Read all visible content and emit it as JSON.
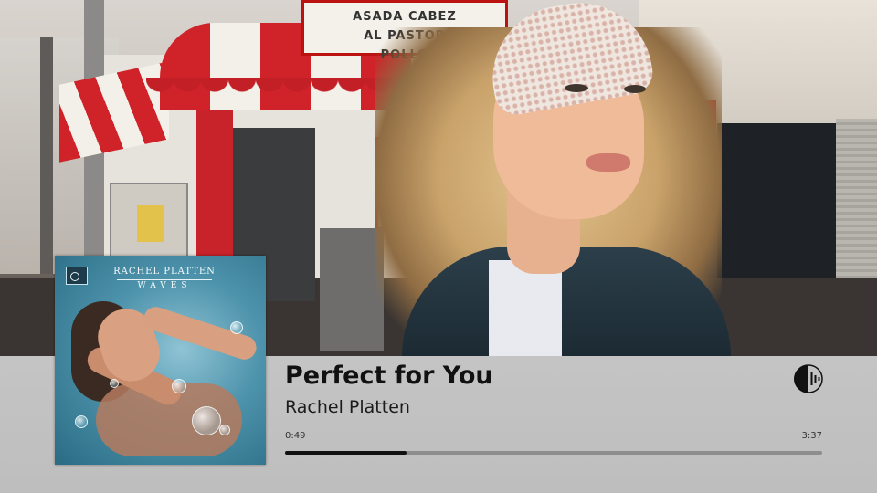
{
  "background": {
    "description_icon": "artist-photo",
    "storefront_sign_lines": [
      "AL PASTOR",
      "ASADA CABEZ",
      "POLLO"
    ]
  },
  "now_playing": {
    "track_title": "Perfect for You",
    "artist": "Rachel Platten",
    "elapsed": "0:49",
    "duration": "3:37",
    "progress_fraction": 0.226,
    "icon": "audio-waveform-icon",
    "album_art": {
      "artist_text": "RACHEL PLATTEN",
      "album_text": "WAVES",
      "label_icon": "columbia-records-logo"
    }
  },
  "colors": {
    "bar_background": "#c4c4c4",
    "progress_fill": "#111111",
    "progress_track": "#8e8e8e",
    "text_primary": "#111111"
  }
}
